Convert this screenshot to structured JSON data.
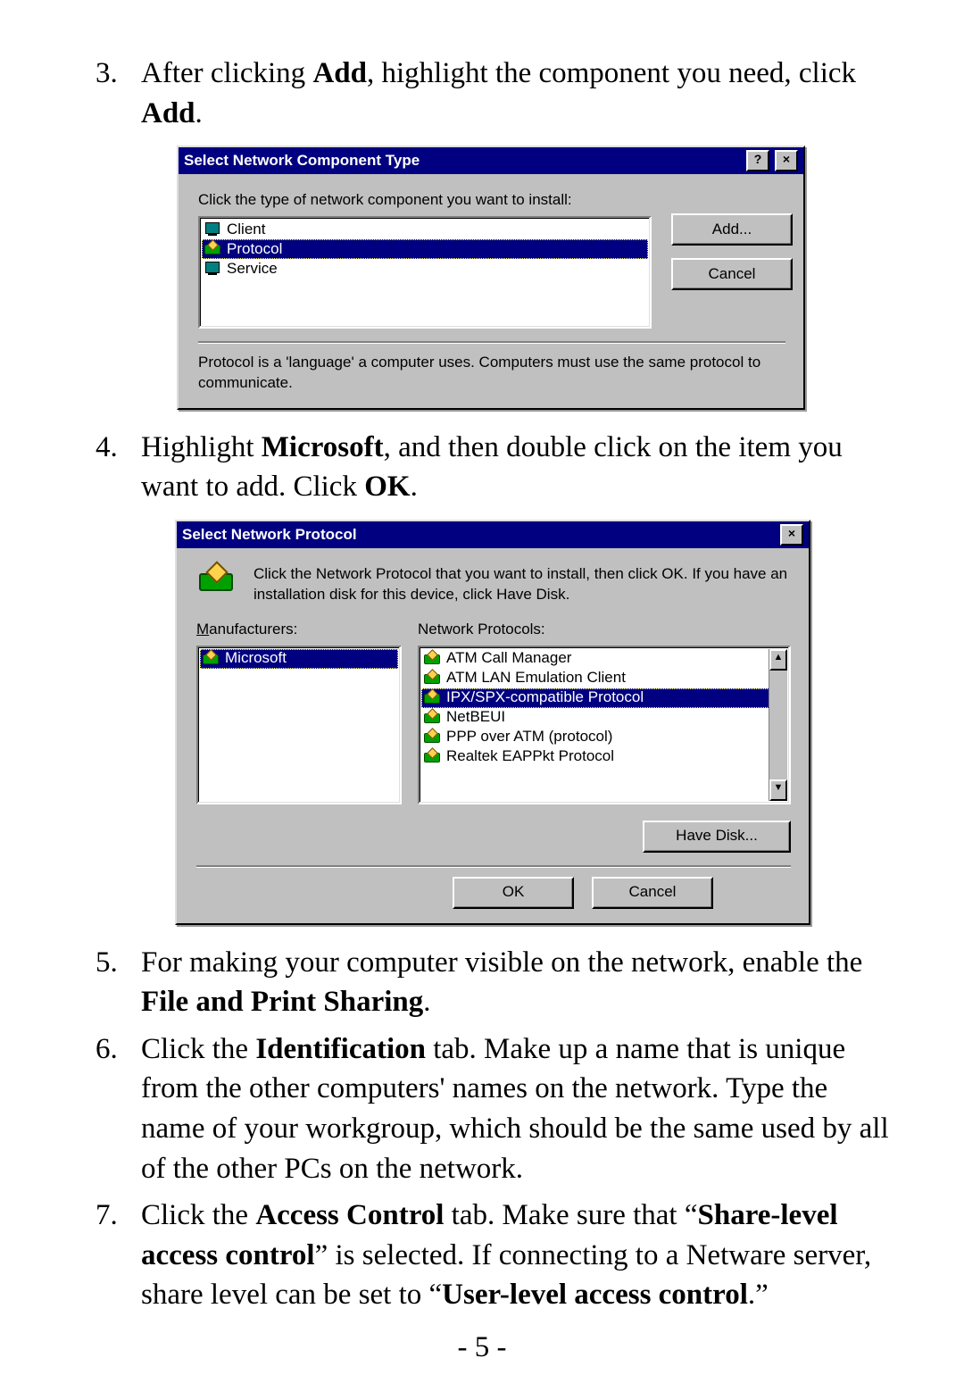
{
  "steps": {
    "3": {
      "pre": "After clicking ",
      "b1": "Add",
      "mid": ", highlight the component you need, click ",
      "b2": "Add",
      "post": "."
    },
    "4": {
      "pre": "Highlight ",
      "b1": "Microsoft",
      "mid": ", and then double click on the item you want to add. Click ",
      "b2": "OK",
      "post": "."
    },
    "5": {
      "pre": "For making your computer visible on the network, enable the ",
      "b1": "File and Print Sharing",
      "post": "."
    },
    "6": {
      "pre": "Click the ",
      "b1": "Identification",
      "post": " tab. Make up a name that is unique from the other computers' names on the network.    Type the name of your workgroup, which should be the same used by all of the other PCs on the network."
    },
    "7": {
      "pre": "Click the ",
      "b1": "Access Control",
      "mid": " tab.    Make sure that “",
      "b2": "Share-level access control",
      "mid2": "” is selected. If connecting to a Netware server, share level can be set to “",
      "b3": "User-level access control",
      "post": ".”"
    }
  },
  "dlg1": {
    "title": "Select Network Component Type",
    "help_btn": "?",
    "close_btn": "×",
    "prompt": "Click the type of network component you want to install:",
    "items": [
      "Client",
      "Protocol",
      "Service"
    ],
    "selected_index": 1,
    "add_btn": "Add...",
    "cancel_btn": "Cancel",
    "description": "Protocol is a 'language' a computer uses. Computers must use the same protocol to communicate."
  },
  "dlg2": {
    "title": "Select Network Protocol",
    "close_btn": "×",
    "intro": "Click the Network Protocol that you want to install, then click OK. If you have an installation disk for this device, click Have Disk.",
    "mfr_label": "Manufacturers:",
    "proto_label": "Network Protocols:",
    "manufacturers": [
      "Microsoft"
    ],
    "mfr_selected_index": 0,
    "protocols": [
      "ATM Call Manager",
      "ATM LAN Emulation Client",
      "IPX/SPX-compatible Protocol",
      "NetBEUI",
      "PPP over ATM (protocol)",
      "Realtek EAPPkt Protocol"
    ],
    "proto_selected_index": 2,
    "have_disk_btn": "Have Disk...",
    "ok_btn": "OK",
    "cancel_btn": "Cancel",
    "scroll_up": "▲",
    "scroll_down": "▼"
  },
  "page_number": "- 5 -"
}
